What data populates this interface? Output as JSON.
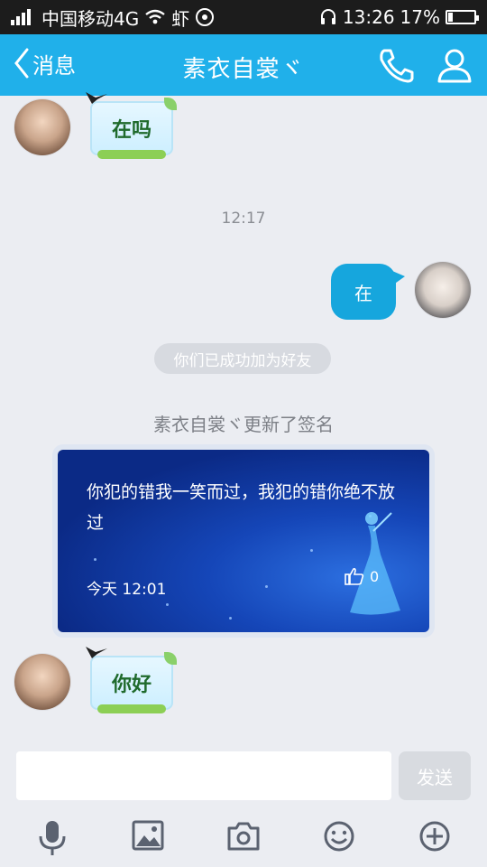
{
  "status_bar": {
    "carrier": "中国移动4G",
    "extra_icons": "虾",
    "time": "13:26",
    "battery": "17%",
    "battery_level": 0.17
  },
  "header": {
    "back_label": "消息",
    "title": "素衣自裳ヾ"
  },
  "messages": {
    "sticker_1": "在吗",
    "timestamp": "12:17",
    "my_bubble": "在",
    "system_notice": "你们已成功加为好友",
    "signature_title": "素衣自裳ヾ更新了签名",
    "signature_text": "你犯的错我一笑而过，我犯的错你绝不放过",
    "signature_time": "今天 12:01",
    "signature_likes": "0",
    "sticker_2": "你好"
  },
  "input": {
    "value": "",
    "send_label": "发送"
  },
  "colors": {
    "header": "#20b0ea",
    "bubble": "#16a6dd",
    "background": "#ebedf2"
  },
  "icons": [
    "back-chevron-icon",
    "phone-icon",
    "person-icon",
    "mic-icon",
    "image-icon",
    "camera-icon",
    "emoji-icon",
    "plus-icon"
  ]
}
